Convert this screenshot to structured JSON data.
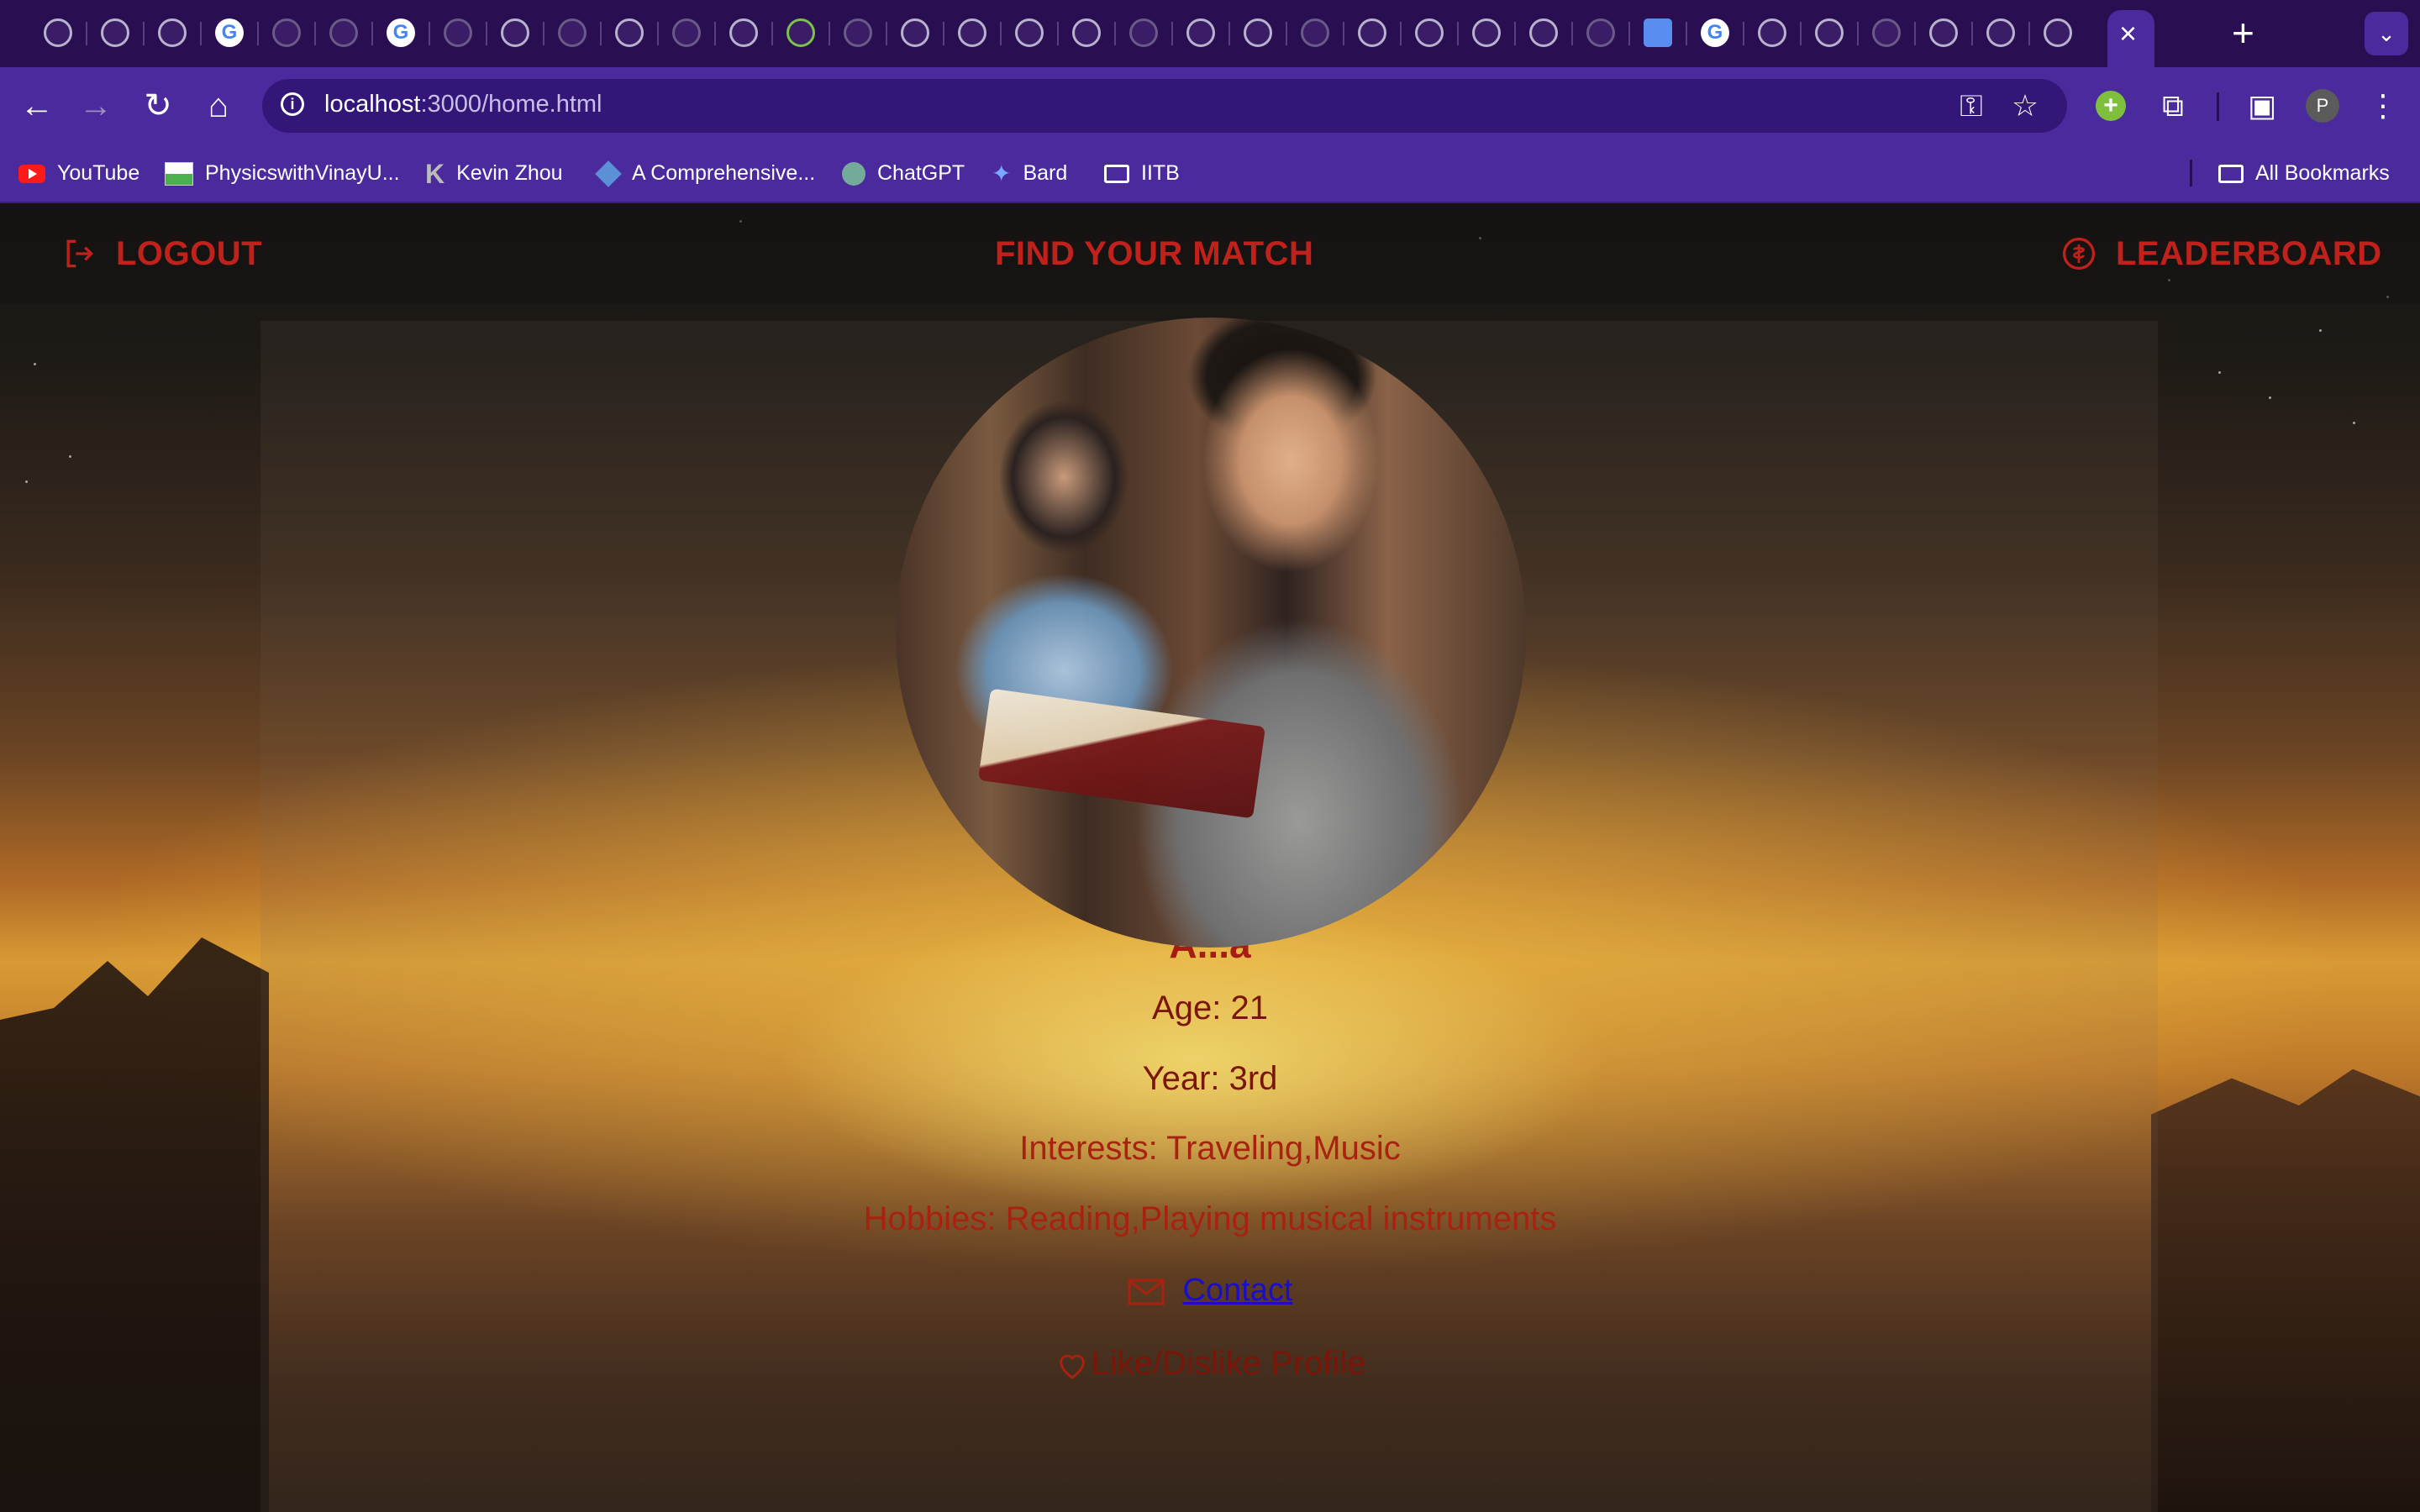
{
  "browser": {
    "url_host": "localhost",
    "url_path": ":3000/home.html",
    "tab_close_glyph": "×",
    "new_tab_glyph": "+",
    "profile_initial": "P",
    "bookmarks": [
      {
        "label": "YouTube",
        "icon": "youtube-icon"
      },
      {
        "label": "PhysicswithVinayU...",
        "icon": "site-icon"
      },
      {
        "label": "Kevin Zhou",
        "icon": "k-icon"
      },
      {
        "label": "A Comprehensive...",
        "icon": "cube-icon"
      },
      {
        "label": "ChatGPT",
        "icon": "chatgpt-icon"
      },
      {
        "label": "Bard",
        "icon": "bard-icon"
      },
      {
        "label": "IITB",
        "icon": "folder-icon"
      }
    ],
    "all_bookmarks_label": "All Bookmarks"
  },
  "header": {
    "logout_label": "LOGOUT",
    "title": "FIND YOUR MATCH",
    "leaderboard_label": "LEADERBOARD"
  },
  "profile": {
    "name": "A...a",
    "age": "Age: 21",
    "year": "Year: 3rd",
    "interests": "Interests: Traveling,Music",
    "hobbies": "Hobbies: Reading,Playing musical instruments",
    "contact_label": "Contact",
    "like_label": "Like/Dislike Profile"
  },
  "colors": {
    "accent_red": "#c0211b",
    "text_dark_red": "#7a1508",
    "link_blue": "#1a0ecc",
    "chrome_purple": "#4a2a9c"
  }
}
